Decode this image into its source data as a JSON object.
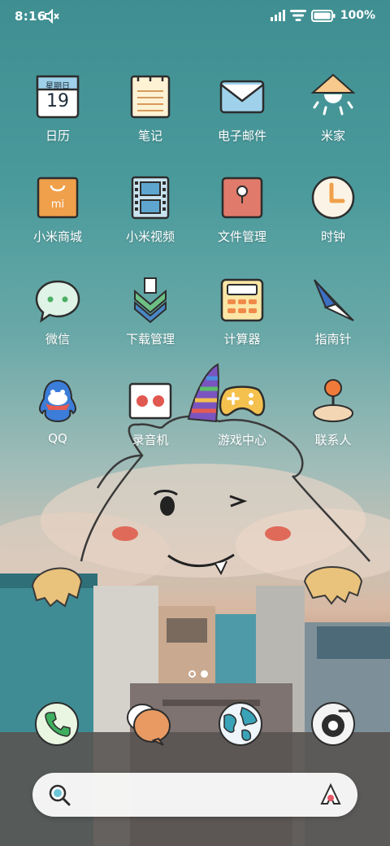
{
  "status_bar": {
    "time": "8:16",
    "battery_text": "100%",
    "icons": [
      "mute-icon",
      "signal-icon",
      "wifi-icon",
      "battery-icon"
    ]
  },
  "apps": [
    {
      "label": "日历",
      "icon": "calendar-icon",
      "calendar_weekday": "星期日",
      "calendar_day": "19"
    },
    {
      "label": "笔记",
      "icon": "notes-icon"
    },
    {
      "label": "电子邮件",
      "icon": "email-icon"
    },
    {
      "label": "米家",
      "icon": "mijia-lamp-icon"
    },
    {
      "label": "小米商城",
      "icon": "mi-store-icon",
      "badge_text": "mi"
    },
    {
      "label": "小米视频",
      "icon": "video-film-icon"
    },
    {
      "label": "文件管理",
      "icon": "file-manager-icon"
    },
    {
      "label": "时钟",
      "icon": "clock-icon"
    },
    {
      "label": "微信",
      "icon": "wechat-icon"
    },
    {
      "label": "下载管理",
      "icon": "download-icon"
    },
    {
      "label": "计算器",
      "icon": "calculator-icon"
    },
    {
      "label": "指南针",
      "icon": "compass-icon"
    },
    {
      "label": "QQ",
      "icon": "qq-penguin-icon"
    },
    {
      "label": "录音机",
      "icon": "recorder-icon"
    },
    {
      "label": "游戏中心",
      "icon": "gamepad-icon"
    },
    {
      "label": "联系人",
      "icon": "contacts-joystick-icon"
    }
  ],
  "page_indicator": {
    "pages": 2,
    "current": 2
  },
  "dock": [
    {
      "name": "phone",
      "icon": "phone-icon"
    },
    {
      "name": "messages",
      "icon": "message-bubble-icon"
    },
    {
      "name": "browser",
      "icon": "globe-icon"
    },
    {
      "name": "camera",
      "icon": "camera-lens-icon"
    }
  ],
  "search_bar": {
    "icons": [
      "search-icon",
      "assistant-icon"
    ]
  },
  "colors": {
    "sky_top": "#3f8f92",
    "calendar_blue": "#9fd2ea",
    "mi_orange": "#f0a04b",
    "file_red": "#e07a6a",
    "icon_outline": "#2d2d2d"
  }
}
